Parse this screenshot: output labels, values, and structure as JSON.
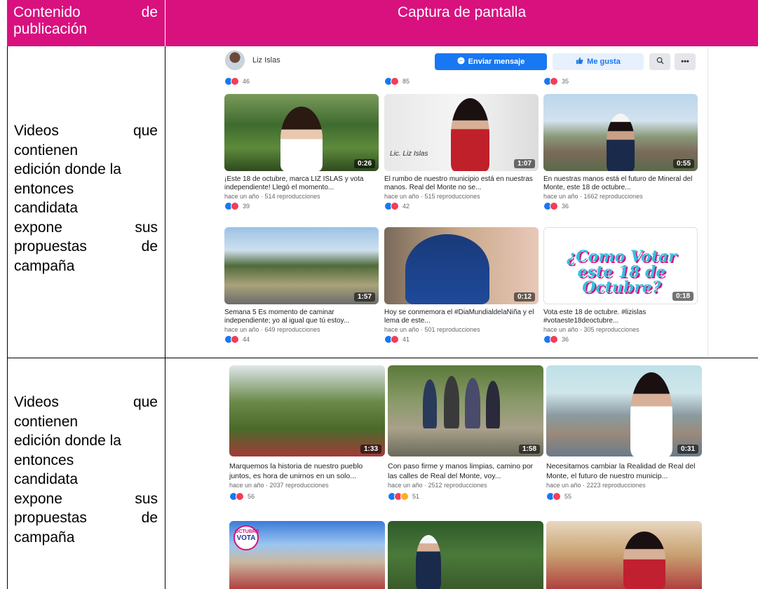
{
  "header": {
    "left_word1": "Contenido",
    "left_word2": "de",
    "left_line2": "publicación",
    "right": "Captura de pantalla"
  },
  "rows": [
    {
      "lines": [
        [
          "Videos",
          "que"
        ],
        [
          "contienen"
        ],
        [
          "edición donde la"
        ],
        [
          "entonces"
        ],
        [
          "candidata"
        ],
        [
          "expone",
          "sus"
        ],
        [
          "propuestas",
          "de"
        ],
        [
          "campaña"
        ]
      ]
    },
    {
      "lines": [
        [
          "Videos",
          "que"
        ],
        [
          "contienen"
        ],
        [
          "edición donde la"
        ],
        [
          "entonces"
        ],
        [
          "candidata"
        ],
        [
          "expone",
          "sus"
        ],
        [
          "propuestas",
          "de"
        ],
        [
          "campaña"
        ]
      ]
    }
  ],
  "fb": {
    "page_name": "Liz Islas",
    "send_message": "Enviar mensaje",
    "like": "Me gusta",
    "top_counts": [
      "46",
      "85",
      "35"
    ],
    "videos": [
      {
        "title": "¡Este 18 de octubre, marca LIZ ISLAS y vota independiente! Llegó el momento...",
        "meta": "hace un año · 514 reproducciones",
        "duration": "0:26",
        "reactions": "39"
      },
      {
        "title": "El rumbo de nuestro municipio está en nuestras manos. Real del Monte no se...",
        "meta": "hace un año · 515 reproducciones",
        "duration": "1:07",
        "reactions": "42",
        "overlay": "Lic. Liz Islas"
      },
      {
        "title": "En nuestras manos está el futuro de Mineral del Monte, este 18 de octubre...",
        "meta": "hace un año · 1662 reproducciones",
        "duration": "0:55",
        "reactions": "36"
      },
      {
        "title": "Semana 5 Es momento de caminar independiente; yo al igual que tú estoy...",
        "meta": "hace un año · 649 reproducciones",
        "duration": "1:57",
        "reactions": "44"
      },
      {
        "title": "Hoy se conmemora el #DiaMundialdelaNiña y el lema de este...",
        "meta": "hace un año · 501 reproducciones",
        "duration": "0:12",
        "reactions": "41"
      },
      {
        "title": "Vota este 18 de octubre. #lizislas #votaeste18deoctubre...",
        "meta": "hace un año · 305 reproducciones",
        "duration": "0:18",
        "reactions": "36",
        "overlay": "¿Como Votar este 18 de Octubre?"
      }
    ],
    "videos2": [
      {
        "title": "Marquemos la historia de nuestro pueblo juntos, es hora de unirnos en un solo...",
        "meta": "hace un año · 2037 reproducciones",
        "duration": "1:33",
        "reactions": "56"
      },
      {
        "title": "Con paso firme y manos limpias, camino por las calles de Real del Monte, voy...",
        "meta": "hace un año · 2512 reproducciones",
        "duration": "1:58",
        "reactions": "51"
      },
      {
        "title": "Necesitamos cambiar la Realidad de Real del Monte, el futuro de nuestro municip...",
        "meta": "hace un año · 2223 reproducciones",
        "duration": "0:31",
        "reactions": "55"
      }
    ],
    "vota_badge": "VOTA",
    "octubre_badge": "OCTUBRE"
  },
  "colors": {
    "accent": "#d8117f",
    "fb_blue": "#1877f2"
  },
  "icons": [
    "messenger-icon",
    "thumbs-up-icon",
    "search-icon",
    "more-icon"
  ]
}
